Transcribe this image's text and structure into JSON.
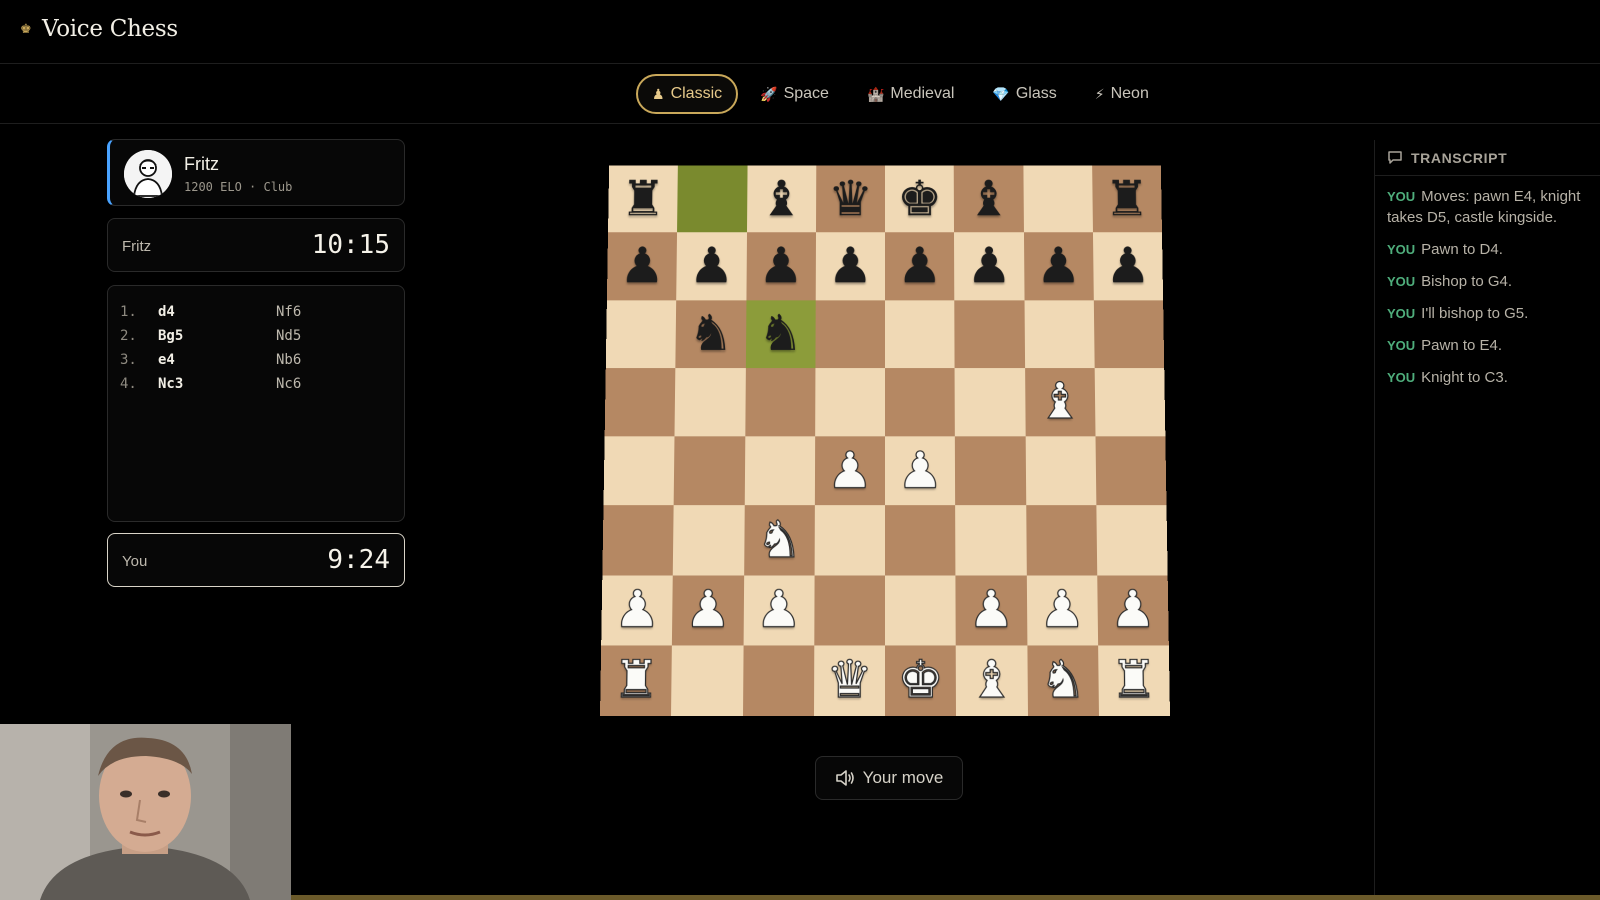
{
  "app": {
    "title": "Voice Chess",
    "logo_icon": "crown-icon"
  },
  "themes": [
    {
      "label": "Classic",
      "icon": "♟",
      "active": true
    },
    {
      "label": "Space",
      "icon": "🚀",
      "active": false
    },
    {
      "label": "Medieval",
      "icon": "🏰",
      "active": false
    },
    {
      "label": "Glass",
      "icon": "💎",
      "active": false
    },
    {
      "label": "Neon",
      "icon": "⚡",
      "active": false
    }
  ],
  "opponent": {
    "name": "Fritz",
    "elo": "1200 ELO · Club",
    "clock_label": "Fritz",
    "clock": "10:15"
  },
  "player": {
    "clock_label": "You",
    "clock": "9:24"
  },
  "moves": [
    {
      "num": "1.",
      "white": "d4",
      "black": "Nf6"
    },
    {
      "num": "2.",
      "white": "Bg5",
      "black": "Nd5"
    },
    {
      "num": "3.",
      "white": "e4",
      "black": "Nb6"
    },
    {
      "num": "4.",
      "white": "Nc3",
      "black": "Nc6"
    }
  ],
  "board": {
    "ranks": [
      [
        "br",
        "",
        "bb",
        "bq",
        "bk",
        "bb",
        "",
        "br"
      ],
      [
        "bp",
        "bp",
        "bp",
        "bp",
        "bp",
        "bp",
        "bp",
        "bp"
      ],
      [
        "",
        "bn",
        "bn",
        "",
        "",
        "",
        "",
        ""
      ],
      [
        "",
        "",
        "",
        "",
        "",
        "",
        "wb",
        ""
      ],
      [
        "",
        "",
        "",
        "wp",
        "wp",
        "",
        "",
        ""
      ],
      [
        "",
        "",
        "wn",
        "",
        "",
        "",
        "",
        ""
      ],
      [
        "wp",
        "wp",
        "wp",
        "",
        "",
        "wp",
        "wp",
        "wp"
      ],
      [
        "wr",
        "",
        "",
        "wq",
        "wk",
        "wb",
        "wn",
        "wr"
      ]
    ],
    "highlighted": [
      [
        0,
        1
      ],
      [
        2,
        2
      ]
    ]
  },
  "status": {
    "label": "Your move",
    "icon": "speaker-icon"
  },
  "transcript": {
    "title": "TRANSCRIPT",
    "icon": "chat-bubble-icon",
    "items": [
      {
        "who": "YOU",
        "text": "Moves: pawn E4, knight takes D5, castle kingside."
      },
      {
        "who": "YOU",
        "text": "Pawn to D4."
      },
      {
        "who": "YOU",
        "text": "Bishop to G4."
      },
      {
        "who": "YOU",
        "text": "I'll bishop to G5."
      },
      {
        "who": "YOU",
        "text": "Pawn to E4."
      },
      {
        "who": "YOU",
        "text": "Knight to C3."
      }
    ]
  },
  "colors": {
    "accent": "#c9a85a",
    "highlight": "#8c9c3a",
    "board_light": "#f0d9b5",
    "board_dark": "#b58863",
    "transcript_you": "#4fae7c"
  }
}
